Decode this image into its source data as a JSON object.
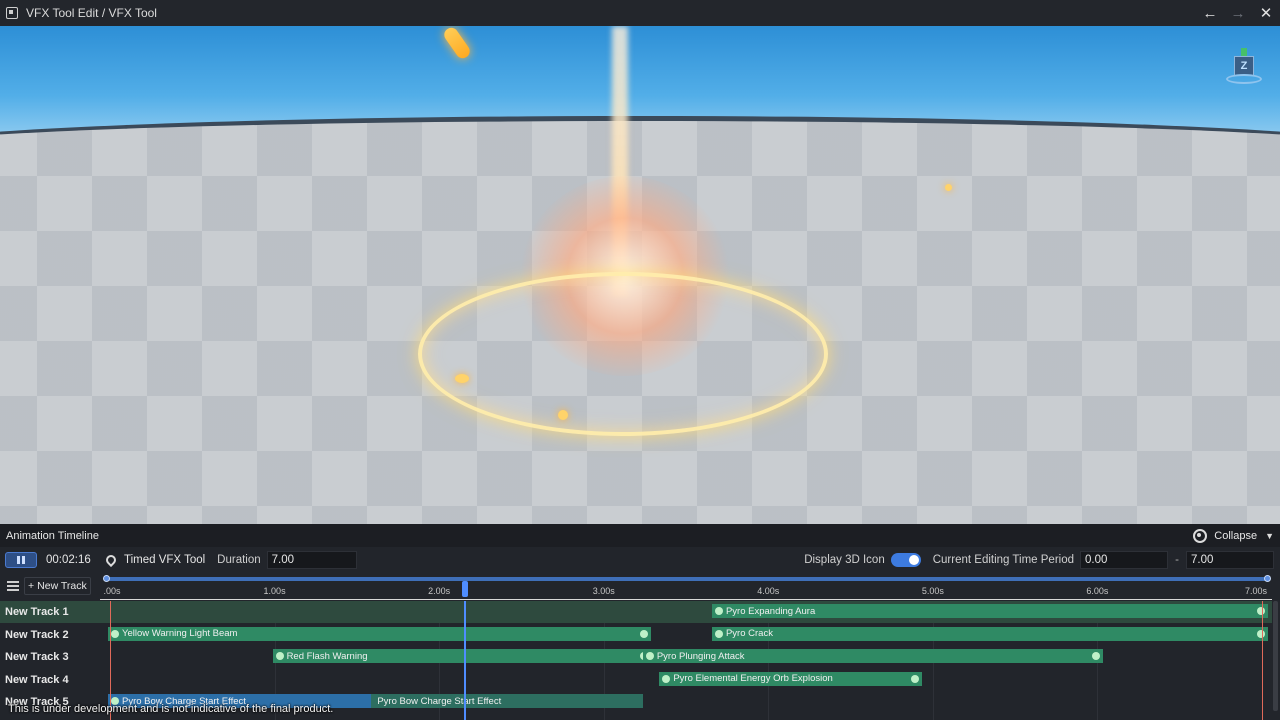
{
  "titlebar": {
    "title": "VFX Tool Edit / VFX Tool",
    "icons": [
      "app-icon",
      "undo-icon",
      "redo-icon",
      "close-icon"
    ]
  },
  "viewport": {
    "axis_label": "Z",
    "colors": {
      "sky": "#52aee8",
      "floor": "#c9cdd1",
      "ring": "#ffe9a8",
      "glow": "#ffaa82"
    }
  },
  "panel": {
    "title": "Animation Timeline",
    "collapse_label": "Collapse"
  },
  "controls": {
    "timecode": "00:02:16",
    "tool_name": "Timed VFX Tool",
    "duration_label": "Duration",
    "duration_value": "7.00",
    "display_3d_label": "Display 3D Icon",
    "display_3d_on": true,
    "period_label": "Current Editing Time Period",
    "period_start": "0.00",
    "period_end": "7.00"
  },
  "timeline": {
    "new_track_label": "New Track",
    "tick_labels": [
      ".00s",
      "1.00s",
      "2.00s",
      "3.00s",
      "4.00s",
      "5.00s",
      "6.00s",
      "7.00s"
    ],
    "tick_seconds": [
      0,
      1,
      2,
      3,
      4,
      5,
      6,
      7
    ],
    "duration_seconds": 7,
    "playhead_seconds": 2.16,
    "tracks": [
      {
        "label": "New Track 1",
        "selected": true
      },
      {
        "label": "New Track 2"
      },
      {
        "label": "New Track 3"
      },
      {
        "label": "New Track 4"
      },
      {
        "label": "New Track 5"
      }
    ],
    "clips": [
      {
        "track": 0,
        "start": 3.67,
        "end": 7.0,
        "label": "Pyro Expanding Aura"
      },
      {
        "track": 1,
        "start": 0.0,
        "end": 3.25,
        "label": "Yellow Warning Light Beam"
      },
      {
        "track": 1,
        "start": 3.67,
        "end": 7.0,
        "label": "Pyro Crack"
      },
      {
        "track": 2,
        "start": 1.0,
        "end": 3.25,
        "label": "Red Flash Warning"
      },
      {
        "track": 2,
        "start": 3.25,
        "end": 6.0,
        "label": "Pyro Plunging Attack"
      },
      {
        "track": 3,
        "start": 3.35,
        "end": 4.9,
        "label": "Pyro Elemental Energy Orb Explosion"
      },
      {
        "track": 4,
        "start": 0.0,
        "end": 1.6,
        "label": "Pyro Bow Charge Start Effect",
        "style": "blue"
      },
      {
        "track": 4,
        "start": 1.6,
        "end": 3.2,
        "label": "Pyro Bow Charge Start Effect",
        "style": "plain"
      }
    ]
  },
  "footer_note": "This is under development and is not indicative of the final product."
}
